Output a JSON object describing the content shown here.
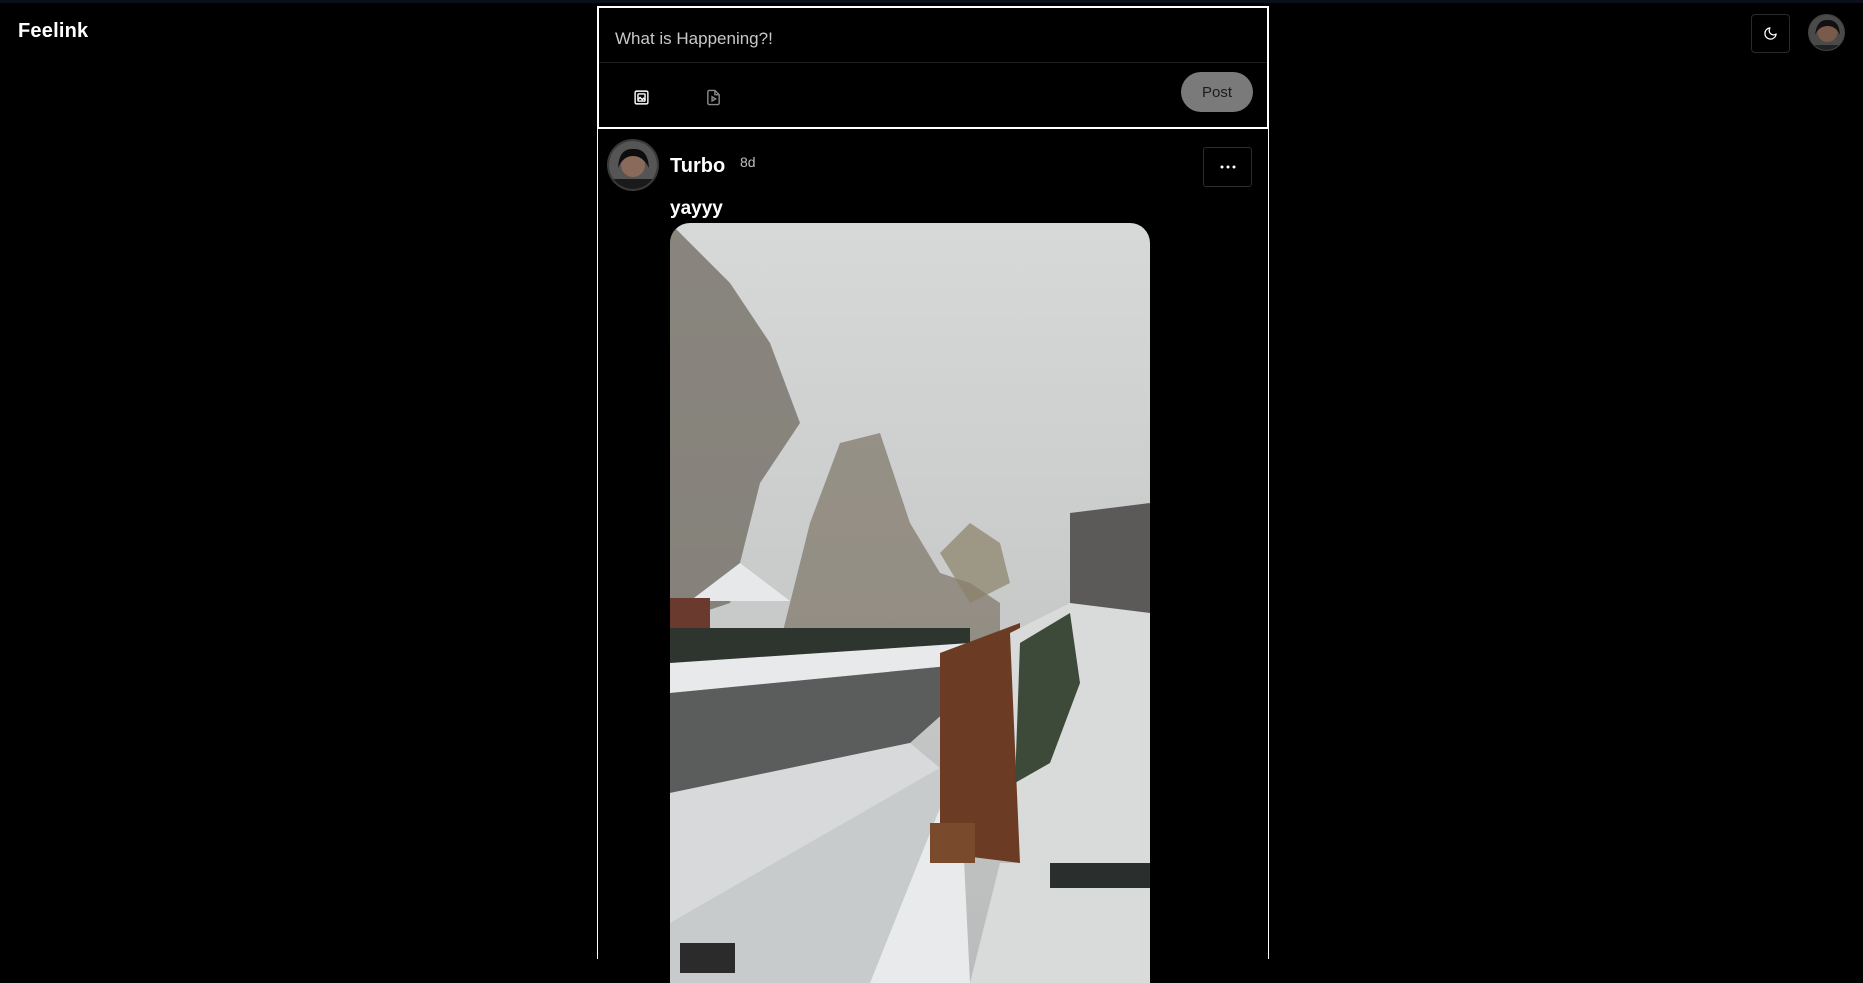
{
  "app": {
    "name": "Feelink"
  },
  "header": {
    "theme_icon": "moon-icon",
    "avatar": "user-avatar"
  },
  "composer": {
    "placeholder": "What is Happening?!",
    "image_tool_icon": "image-icon",
    "video_tool_icon": "video-file-icon",
    "post_label": "Post"
  },
  "feed": {
    "posts": [
      {
        "username": "Turbo",
        "time": "8d",
        "text": "yayyy",
        "more_icon": "ellipsis-icon",
        "media": "photo"
      }
    ]
  },
  "colors": {
    "background": "#000000",
    "text": "#ffffff",
    "post_button_bg": "#7a7a7a",
    "muted_text": "#bdbdbd"
  }
}
